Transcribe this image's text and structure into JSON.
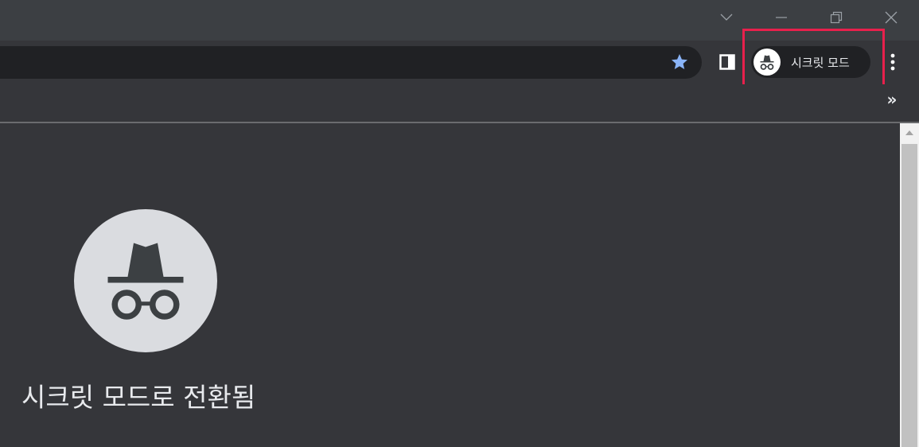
{
  "toolbar": {
    "profile_chip_label": "시크릿 모드",
    "bookmarks_overflow": "»"
  },
  "content": {
    "heading": "시크릿 모드로 전환됨"
  },
  "colors": {
    "highlight": "#e8204c",
    "star": "#8ab4f8",
    "background": "#35363a",
    "omnibox": "#202124"
  },
  "icons": {
    "window_controls": [
      "chevron-down-icon",
      "minimize-icon",
      "restore-icon",
      "close-icon"
    ],
    "toolbar": [
      "bookmark-star-icon",
      "side-panel-icon",
      "incognito-icon",
      "more-menu-icon"
    ]
  }
}
